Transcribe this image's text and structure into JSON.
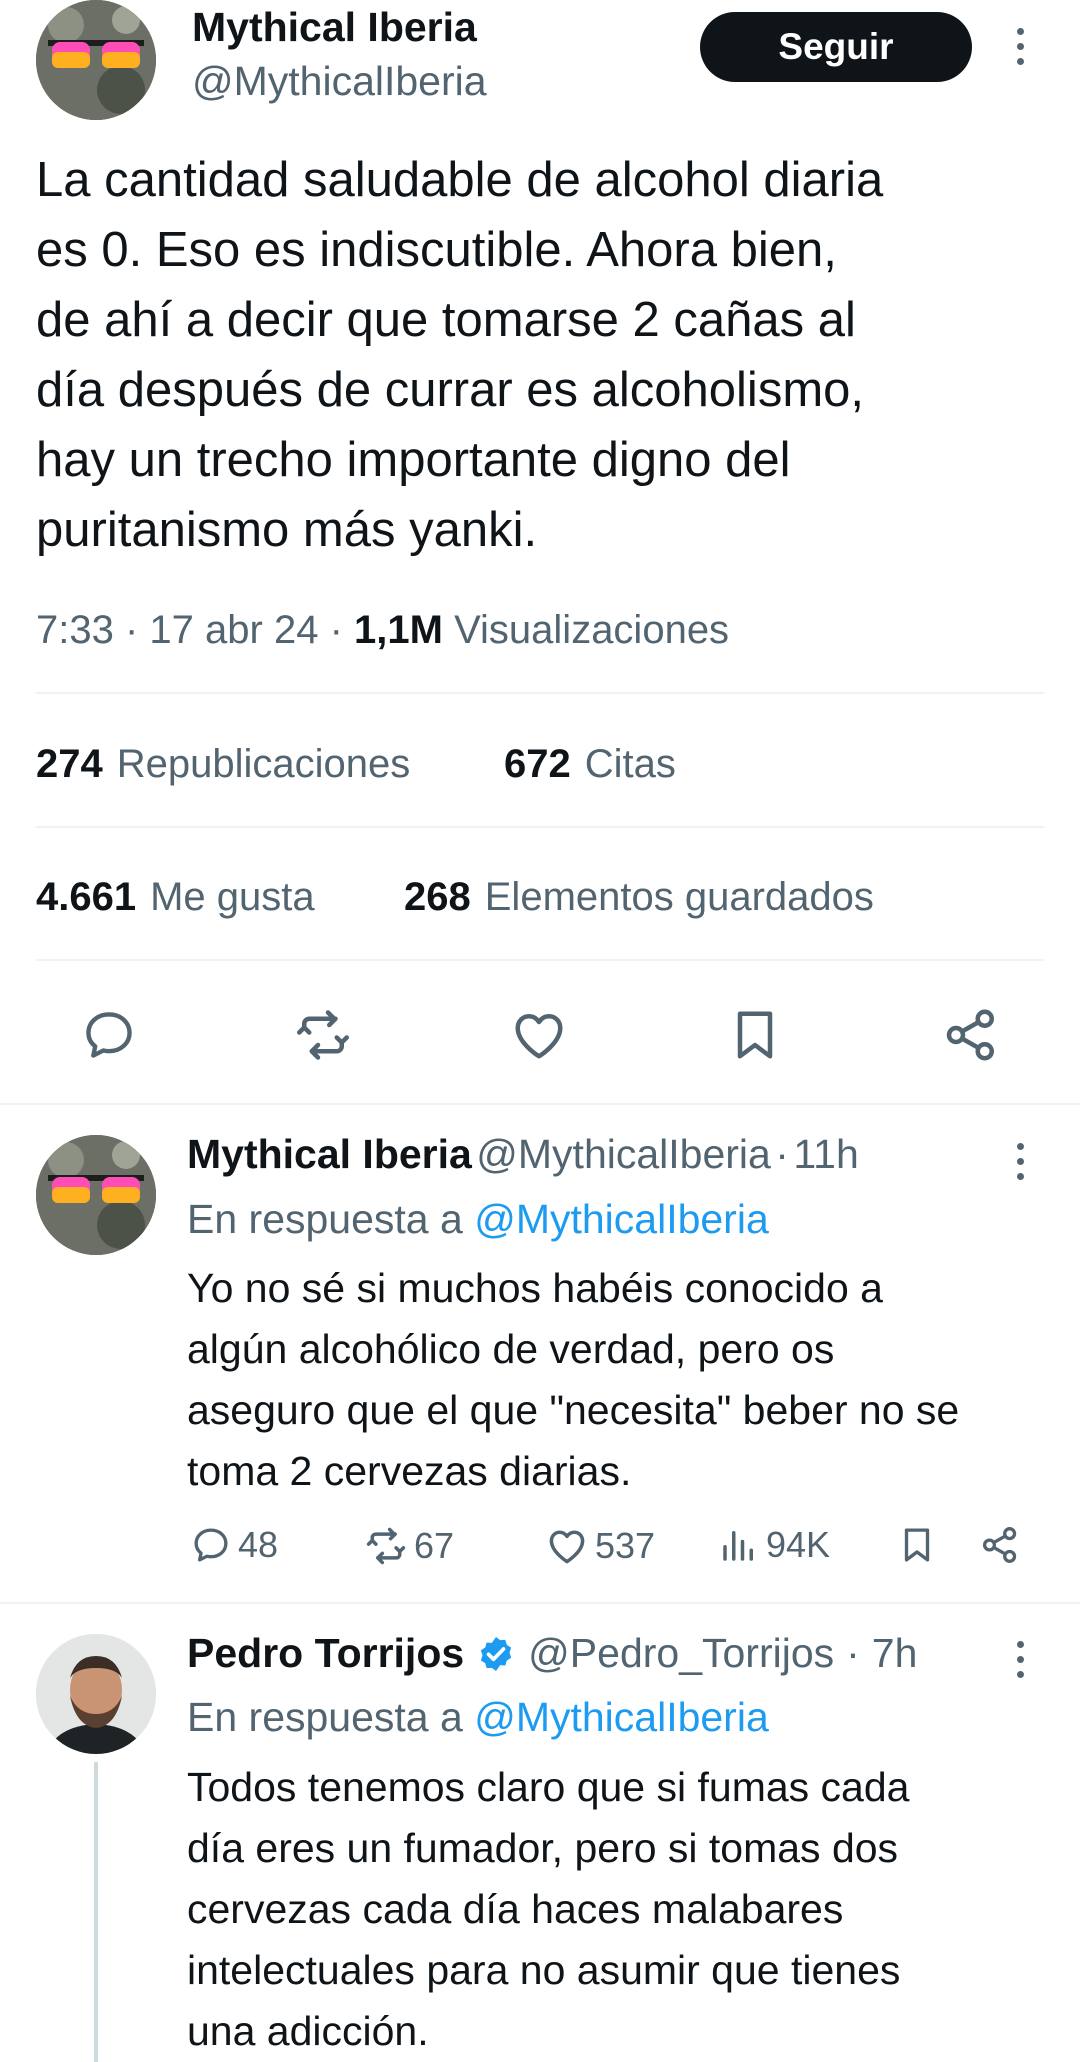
{
  "main_tweet": {
    "author_name": "Mythical Iberia",
    "author_handle": "@MythicalIberia",
    "follow_label": "Seguir",
    "text_lines": [
      "La cantidad saludable de alcohol diaria",
      "es 0. Eso es indiscutible. Ahora bien,",
      "de ahí a decir que tomarse 2 cañas al",
      "día después de currar es alcoholismo,",
      "hay un trecho importante digno del",
      "puritanismo más yanki."
    ],
    "time": "7:33",
    "date": "17 abr 24",
    "views_count": "1,1M",
    "views_label": "Visualizaciones",
    "retweets_count": "274",
    "retweets_label": "Republicaciones",
    "quotes_count": "672",
    "quotes_label": "Citas",
    "likes_count": "4.661",
    "likes_label": "Me gusta",
    "bookmarks_count": "268",
    "bookmarks_label": "Elementos guardados"
  },
  "replies": [
    {
      "author_name": "Mythical Iberia",
      "author_handle": "@MythicalIberia",
      "age": "11h",
      "reply_prefix": "En respuesta a",
      "reply_to": "@MythicalIberia",
      "text_lines": [
        "Yo no sé si muchos habéis conocido a",
        "algún alcohólico de verdad, pero os",
        "aseguro que el que \"necesita\" beber no se",
        "toma 2 cervezas diarias."
      ],
      "reply_count": "48",
      "retweet_count": "67",
      "like_count": "537",
      "view_count": "94K"
    },
    {
      "author_name": "Pedro Torrijos",
      "author_handle": "@Pedro_Torrijos",
      "age": "7h",
      "verified": true,
      "reply_prefix": "En respuesta a",
      "reply_to": "@MythicalIberia",
      "text_lines": [
        "Todos tenemos claro que si fumas cada",
        "día eres un fumador, pero si tomas dos",
        "cervezas cada día haces malabares",
        "intelectuales para no asumir que tienes",
        "una adicción."
      ]
    }
  ],
  "colors": {
    "text_primary": "#0f1419",
    "text_secondary": "#536471",
    "link": "#1d9bf0",
    "divider": "#eff3f4",
    "verified": "#1d9bf0"
  },
  "icons": [
    "reply-icon",
    "retweet-icon",
    "like-icon",
    "bookmark-icon",
    "share-icon",
    "views-icon",
    "verified-badge-icon",
    "more-icon"
  ]
}
